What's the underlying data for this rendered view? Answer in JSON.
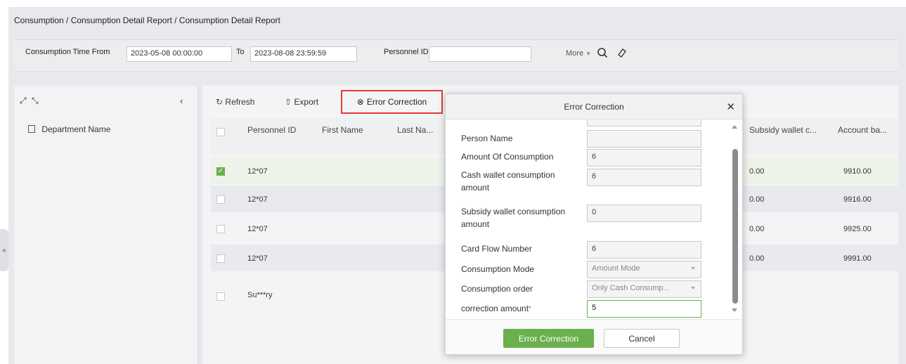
{
  "breadcrumb": "Consumption / Consumption Detail Report / Consumption Detail Report",
  "filters": {
    "time_from_label": "Consumption Time From",
    "time_from_value": "2023-05-08 00:00:00",
    "to_label": "To",
    "to_value": "2023-08-08 23:59:59",
    "personnel_id_label": "Personnel ID",
    "personnel_id_value": "",
    "more_label": "More"
  },
  "left_panel": {
    "department_header": "Department Name"
  },
  "toolbar": {
    "refresh": "Refresh",
    "export": "Export",
    "error_correction": "Error Correction"
  },
  "table": {
    "columns": [
      "Personnel ID",
      "First Name",
      "Last Na...",
      "Subsidy wallet c...",
      "Account ba..."
    ],
    "rows": [
      {
        "personnel_id": "12*07",
        "subsidy": "0.00",
        "balance": "9910.00",
        "checked": true
      },
      {
        "personnel_id": "12*07",
        "subsidy": "0.00",
        "balance": "9916.00",
        "checked": false
      },
      {
        "personnel_id": "12*07",
        "subsidy": "0.00",
        "balance": "9925.00",
        "checked": false
      },
      {
        "personnel_id": "12*07",
        "subsidy": "0.00",
        "balance": "9991.00",
        "checked": false
      },
      {
        "personnel_id": "Su***ry",
        "subsidy": "",
        "balance": "",
        "checked": false
      }
    ]
  },
  "modal": {
    "title": "Error Correction",
    "fields": {
      "person_name_label": "Person Name",
      "person_name_value": "",
      "amount_label": "Amount Of Consumption",
      "amount_value": "6",
      "cash_label": "Cash wallet consumption amount",
      "cash_value": "6",
      "subsidy_label": "Subsidy wallet consumption amount",
      "subsidy_value": "0",
      "card_flow_label": "Card Flow Number",
      "card_flow_value": "6",
      "mode_label": "Consumption Mode",
      "mode_value": "Amount Mode",
      "order_label": "Consumption order",
      "order_value": "Only Cash Consump...",
      "correction_label": "correction amount",
      "correction_required": "*",
      "correction_value": "5"
    },
    "confirm_button": "Error Correction",
    "cancel_button": "Cancel"
  },
  "colors": {
    "accent_green": "#6ab04c",
    "highlight_red": "#e53935"
  }
}
